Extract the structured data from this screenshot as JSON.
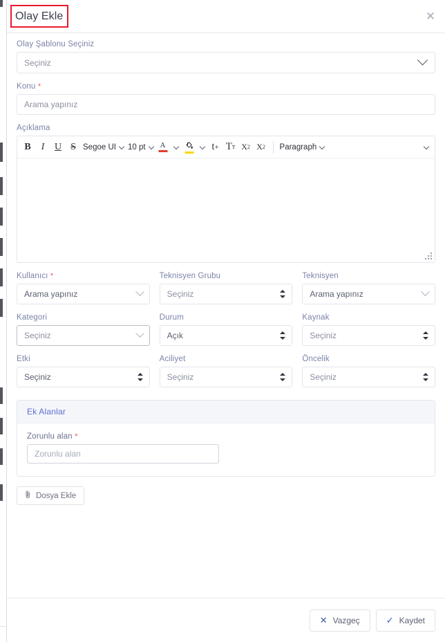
{
  "modal": {
    "title": "Olay Ekle",
    "close_icon": "close-icon"
  },
  "form": {
    "template": {
      "label": "Olay Şablonu Seçiniz",
      "value": "Seçiniz",
      "icon": "chevron-down-icon"
    },
    "subject": {
      "label": "Konu",
      "required": "*",
      "placeholder": "Arama yapınız"
    },
    "description": {
      "label": "Açıklama",
      "content": ""
    },
    "fields": [
      {
        "label": "Kullanıcı",
        "required": "*",
        "value": "Arama yapınız",
        "control": "search-select"
      },
      {
        "label": "Teknisyen Grubu",
        "required": "",
        "value": "Seçiniz",
        "control": "native-select"
      },
      {
        "label": "Teknisyen",
        "required": "",
        "value": "Arama yapınız",
        "control": "search-select"
      },
      {
        "label": "Kategori",
        "required": "",
        "value": "Seçiniz",
        "control": "search-select-disabled"
      },
      {
        "label": "Durum",
        "required": "",
        "value": "Açık",
        "control": "native-select"
      },
      {
        "label": "Kaynak",
        "required": "",
        "value": "Seçiniz",
        "control": "native-select"
      },
      {
        "label": "Etki",
        "required": "",
        "value": "Seçiniz",
        "control": "native-select"
      },
      {
        "label": "Aciliyet",
        "required": "",
        "value": "Seçiniz",
        "control": "native-select"
      },
      {
        "label": "Öncelik",
        "required": "",
        "value": "Seçiniz",
        "control": "native-select"
      }
    ]
  },
  "editor_toolbar": {
    "bold": "B",
    "italic": "I",
    "underline": "U",
    "strikethrough": "S",
    "font_family": "Segoe UI",
    "font_size": "10 pt",
    "font_color_glyph": "A",
    "highlight_glyph": "◉",
    "increase_font": "t",
    "increase_font_plus": "+",
    "decrease_font": "T",
    "decrease_font_small": "T",
    "superscript_base": "X",
    "superscript_exp": "2",
    "subscript_base": "X",
    "subscript_exp": "2",
    "paragraph": "Paragraph",
    "expand_icon": "chevron-down-icon"
  },
  "extra_fields": {
    "panel_title": "Ek Alanlar",
    "field_label": "Zorunlu alan",
    "field_required": "*",
    "field_placeholder": "Zorunlu alan"
  },
  "attachment": {
    "label": "Dosya Ekle",
    "icon": "paperclip-icon"
  },
  "footer": {
    "cancel_label": "Vazgeç",
    "cancel_icon": "close-icon",
    "save_label": "Kaydet",
    "save_icon": "check-icon"
  },
  "colors": {
    "label": "#7b83a8",
    "required": "#f2545b",
    "annotation": "#e8192c",
    "panel_title": "#5a6fd0",
    "button_icon": "#3c5a9a",
    "font_color_underline": "#e23b2e",
    "highlight_underline": "#f5d800"
  }
}
